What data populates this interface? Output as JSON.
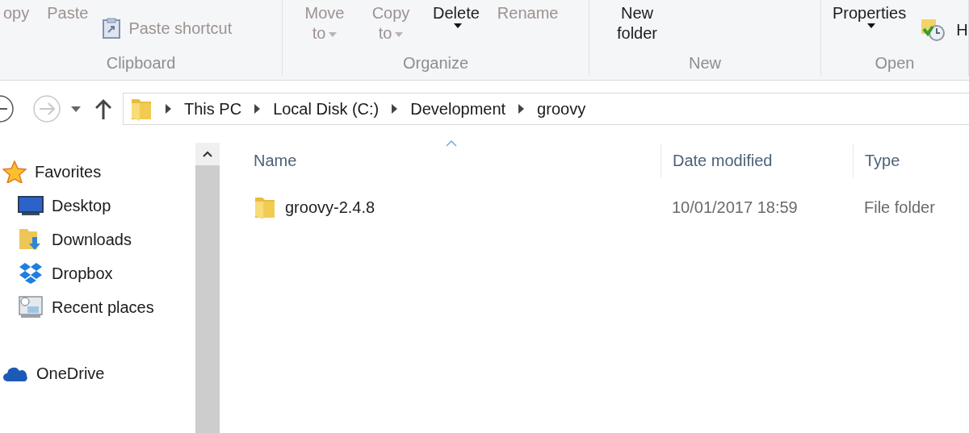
{
  "ribbon": {
    "groups": [
      {
        "label": "Clipboard",
        "buttons": [
          {
            "kind": "large",
            "label": "opy",
            "disabled": true
          },
          {
            "kind": "large",
            "label": "Paste",
            "disabled": true
          },
          {
            "kind": "small",
            "label": "Paste shortcut",
            "disabled": true
          }
        ]
      },
      {
        "label": "Organize",
        "buttons": [
          {
            "kind": "menu-inline",
            "label": "Move to",
            "disabled": true
          },
          {
            "kind": "menu-inline",
            "label": "Copy to",
            "disabled": true
          },
          {
            "kind": "menu-below",
            "label": "Delete",
            "disabled": false
          },
          {
            "kind": "large",
            "label": "Rename",
            "disabled": true
          }
        ]
      },
      {
        "label": "New",
        "buttons": [
          {
            "kind": "large",
            "label": "New folder",
            "disabled": false
          }
        ]
      },
      {
        "label": "Open",
        "buttons": [
          {
            "kind": "menu-below",
            "label": "Properties",
            "disabled": false
          },
          {
            "kind": "small",
            "label": "H",
            "disabled": false
          }
        ]
      }
    ]
  },
  "address_bar": {
    "back_disabled": false,
    "forward_disabled": true,
    "path": [
      "This PC",
      "Local Disk (C:)",
      "Development",
      "groovy"
    ]
  },
  "navigation_pane": {
    "items": [
      {
        "kind": "star",
        "label": "Favorites",
        "selected": false,
        "children": [
          {
            "kind": "monitor",
            "label": "Desktop",
            "selected": false
          },
          {
            "kind": "download-folder",
            "label": "Downloads",
            "selected": false
          },
          {
            "kind": "box",
            "label": "Dropbox",
            "selected": false
          },
          {
            "kind": "recent",
            "label": "Recent places",
            "selected": false
          }
        ]
      },
      {
        "kind": "cloud",
        "label": "OneDrive",
        "selected": false
      }
    ]
  },
  "file_list": {
    "columns": [
      {
        "label": "Name",
        "sorted": true
      },
      {
        "label": "Date modified",
        "sorted": false
      },
      {
        "label": "Type",
        "sorted": false
      }
    ],
    "rows": [
      {
        "name": "groovy-2.4.8",
        "date_modified": "10/01/2017 18:59",
        "type": "File folder",
        "selected": false
      }
    ]
  }
}
